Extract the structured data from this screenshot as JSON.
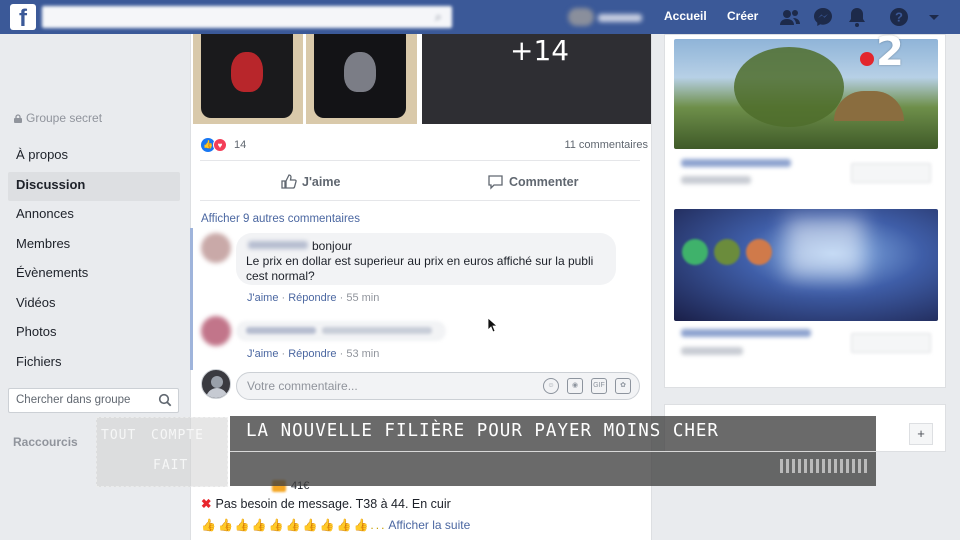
{
  "topbar": {
    "logo_letter": "f",
    "nav_home": "Accueil",
    "nav_create": "Créer",
    "icons": [
      "friends-icon",
      "messenger-icon",
      "notifications-icon",
      "help-icon",
      "menu-caret-icon"
    ]
  },
  "left": {
    "privacy": "Groupe secret",
    "nav": [
      "À propos",
      "Discussion",
      "Annonces",
      "Membres",
      "Évènements",
      "Vidéos",
      "Photos",
      "Fichiers"
    ],
    "active_nav": "Discussion",
    "search_placeholder": "Chercher dans groupe",
    "shortcuts": "Raccourcis"
  },
  "post": {
    "extra_photos": "+14",
    "reaction_count": "14",
    "comments_count": "11 commentaires",
    "like_label": "J'aime",
    "comment_label": "Commenter",
    "more_comments": "Afficher 9 autres commentaires",
    "comment1": {
      "greeting": "bonjour",
      "text": "Le prix en dollar est superieur au prix en euros affiché sur la publi cest normal?",
      "like": "J'aime",
      "reply": "Répondre",
      "time": "55 min"
    },
    "comment2": {
      "like": "J'aime",
      "reply": "Répondre",
      "time": "53 min"
    },
    "input_placeholder": "Votre commentaire...",
    "price": "41€",
    "body_text": "Pas besoin de message. T38 à 44. En cuir",
    "see_more": "Afficher la suite",
    "emoji_row": "👍👍👍👍👍👍👍👍👍👍..."
  },
  "overlay": {
    "show_logo_words": [
      "TOUT",
      "COMPTE",
      "FAIT"
    ],
    "banner_title": "LA NOUVELLE FILIÈRE POUR PAYER MOINS CHER",
    "channel_number": "2",
    "channel_dot_color": "#e3262d"
  },
  "colors": {
    "facebook_blue": "#3b5998",
    "link_blue": "#4b67a1",
    "page_bg": "#e9ebee"
  }
}
